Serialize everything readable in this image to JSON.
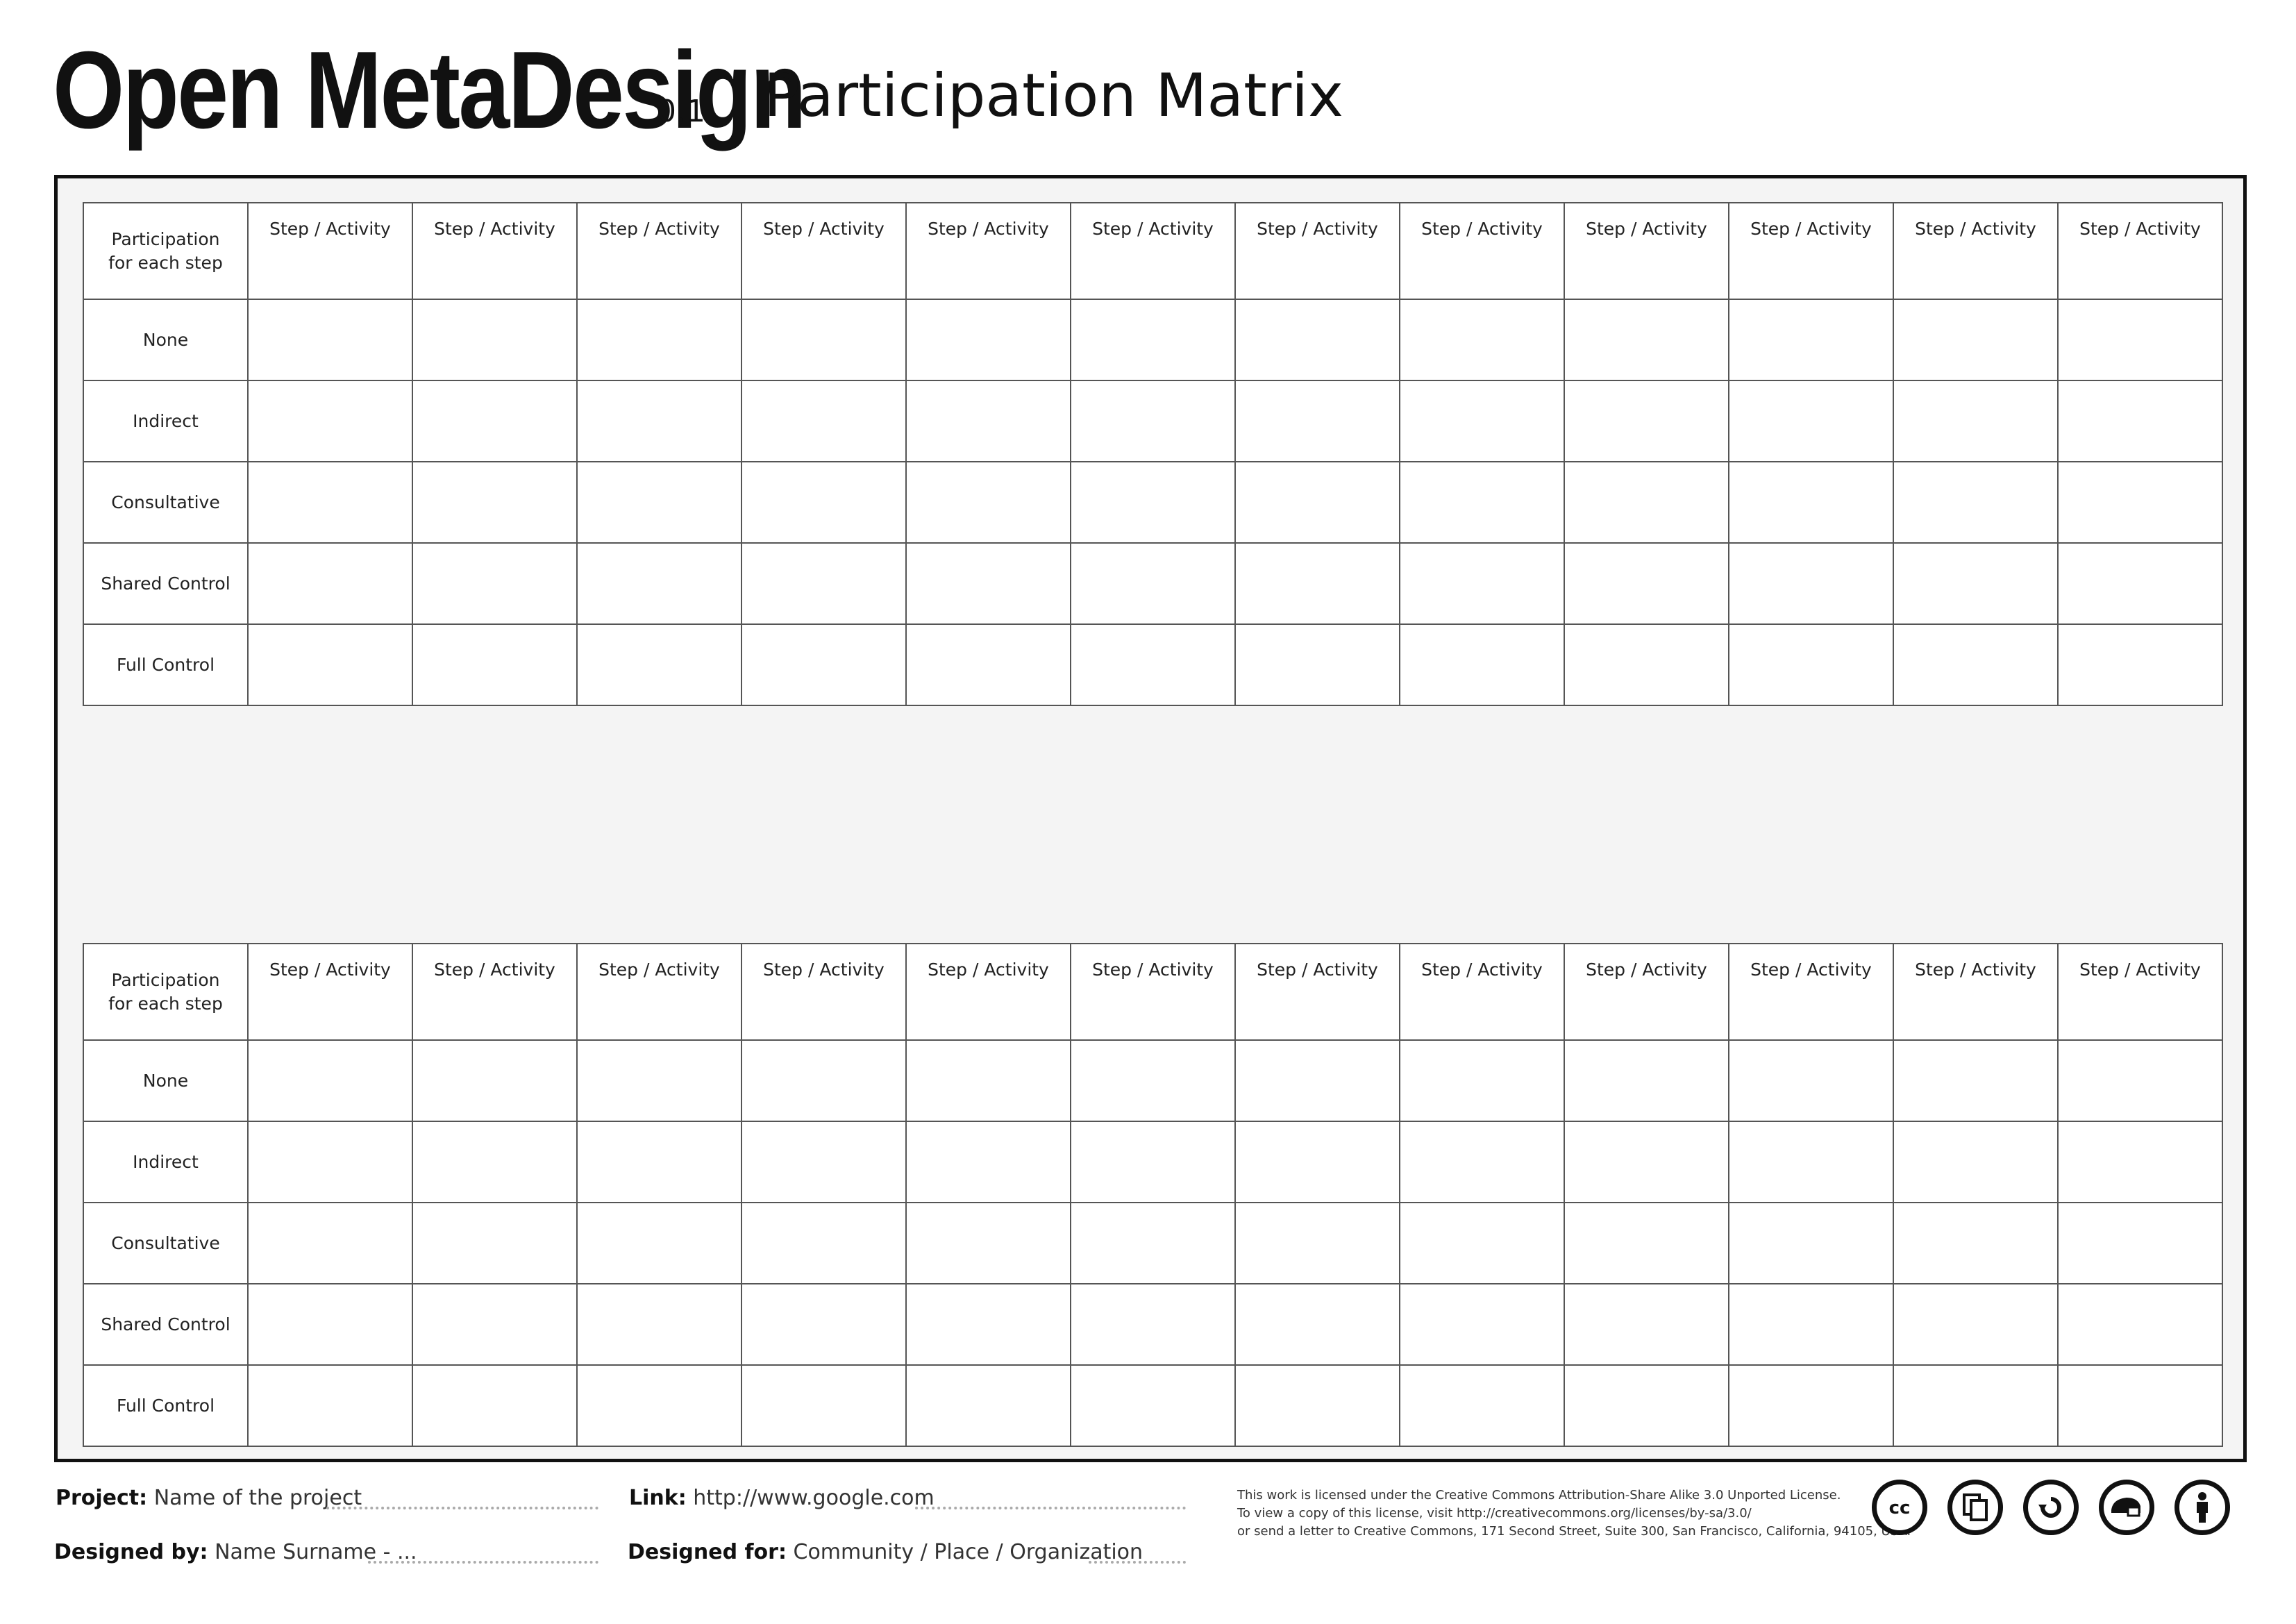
{
  "header": {
    "brand": "Open MetaDesign",
    "version": "0.1",
    "title": "Participation Matrix"
  },
  "matrix": {
    "corner_line1": "Participation",
    "corner_line2": "for each step",
    "step_labels": [
      "Step / Activity",
      "Step / Activity",
      "Step / Activity",
      "Step / Activity",
      "Step / Activity",
      "Step / Activity",
      "Step / Activity",
      "Step / Activity",
      "Step / Activity",
      "Step / Activity",
      "Step / Activity",
      "Step / Activity"
    ],
    "rows": [
      "None",
      "Indirect",
      "Consultative",
      "Shared Control",
      "Full Control"
    ]
  },
  "footer": {
    "project_label": "Project:",
    "project_value": "Name of the project",
    "link_label": "Link:",
    "link_value": "http://www.google.com",
    "designed_by_label": "Designed by:",
    "designed_by_value": "Name Surname - ...",
    "designed_for_label": "Designed for:",
    "designed_for_value": "Community / Place / Organization",
    "license_line1": "This work is licensed under the Creative Commons Attribution-Share Alike 3.0 Unported License.",
    "license_line2": "To view a copy of this license, visit http://creativecommons.org/licenses/by-sa/3.0/",
    "license_line3": "or send a letter to Creative Commons, 171 Second Street, Suite 300, San Francisco, California, 94105, USA.",
    "icons": [
      "cc-icon",
      "copy-icon",
      "sharealike-icon",
      "remix-icon",
      "attribution-icon"
    ]
  }
}
